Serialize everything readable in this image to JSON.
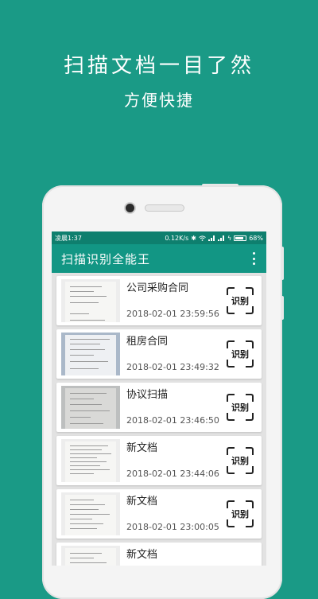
{
  "promo": {
    "headline": "扫描文档一目了然",
    "subheadline": "方便快捷"
  },
  "statusbar": {
    "time": "凌晨1:37",
    "speed": "0.12K/s",
    "battery": "68%",
    "icons": [
      "bluetooth-icon",
      "wifi-icon",
      "signal-icon",
      "charging-icon",
      "battery-icon"
    ]
  },
  "appbar": {
    "title": "扫描识别全能王",
    "menu_icon": "more-vertical-icon"
  },
  "documents": [
    {
      "name": "公司采购合同",
      "date": "2018-02-01 23:59:56",
      "action": "识别"
    },
    {
      "name": "租房合同",
      "date": "2018-02-01 23:49:32",
      "action": "识别"
    },
    {
      "name": "协议扫描",
      "date": "2018-02-01 23:46:50",
      "action": "识别"
    },
    {
      "name": "新文档",
      "date": "2018-02-01 23:44:06",
      "action": "识别"
    },
    {
      "name": "新文档",
      "date": "2018-02-01 23:00:05",
      "action": "识别"
    },
    {
      "name": "新文档",
      "date": "",
      "action": ""
    }
  ],
  "colors": {
    "background": "#1a9a86",
    "appbar": "#129684",
    "statusbar": "#0e7f6e"
  }
}
